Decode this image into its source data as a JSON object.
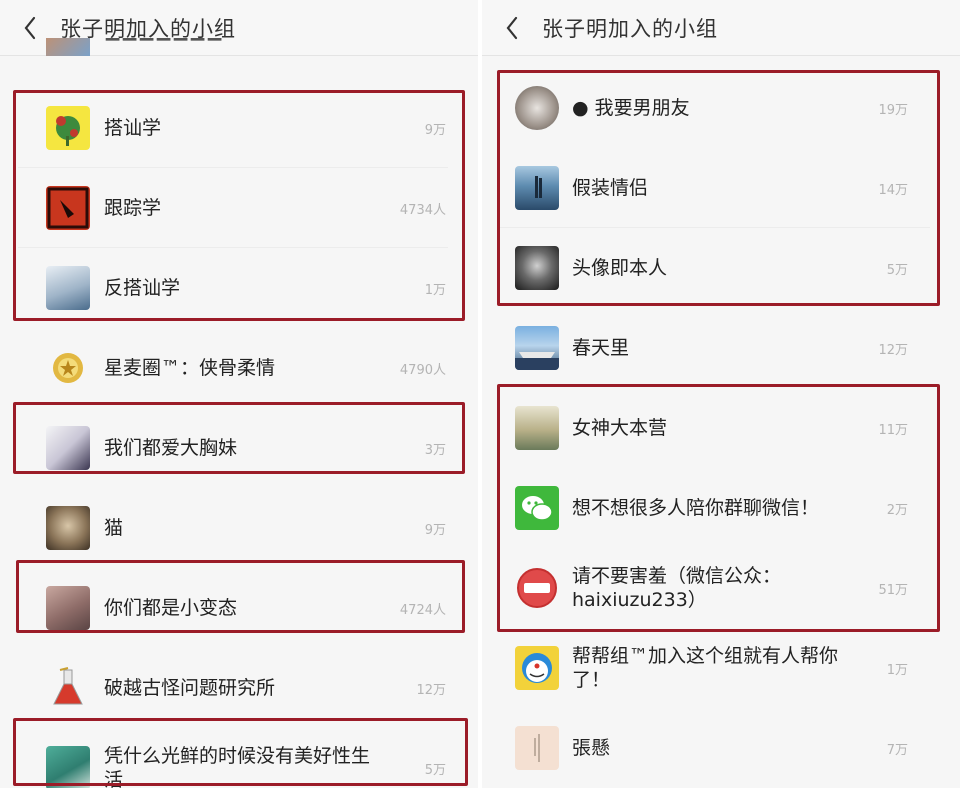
{
  "left_panel": {
    "title": "张子明加入的小组",
    "clipped_top_row": {
      "name": "",
      "avatar_icon": "clipped-avatar-icon"
    },
    "groups": [
      {
        "name": "搭讪学",
        "count": "9万",
        "avatar_icon": "flower-avatar-icon"
      },
      {
        "name": "跟踪学",
        "count": "4734人",
        "avatar_icon": "shoe-avatar-icon"
      },
      {
        "name": "反搭讪学",
        "count": "1万",
        "avatar_icon": "photo-avatar-icon"
      },
      {
        "name": "星麦圈™：侠骨柔情",
        "count": "4790人",
        "avatar_icon": "badge-avatar-icon"
      },
      {
        "name": "我们都爱大胸妹",
        "count": "3万",
        "avatar_icon": "photo-avatar-icon"
      },
      {
        "name": "猫",
        "count": "9万",
        "avatar_icon": "cat-avatar-icon"
      },
      {
        "name": "你们都是小变态",
        "count": "4724人",
        "avatar_icon": "photo-avatar-icon"
      },
      {
        "name": "破越古怪问题研究所",
        "count": "12万",
        "avatar_icon": "flask-avatar-icon"
      },
      {
        "name": "凭什么光鲜的时候没有美好性生活",
        "count": "5万",
        "avatar_icon": "photo-avatar-icon"
      }
    ]
  },
  "right_panel": {
    "title": "张子明加入的小组",
    "groups": [
      {
        "name": "● 我要男朋友",
        "count": "19万",
        "avatar_icon": "sketch-avatar-icon"
      },
      {
        "name": "假装情侣",
        "count": "14万",
        "avatar_icon": "seaside-avatar-icon"
      },
      {
        "name": "头像即本人",
        "count": "5万",
        "avatar_icon": "face-avatar-icon"
      },
      {
        "name": "春天里",
        "count": "12万",
        "avatar_icon": "harbor-avatar-icon"
      },
      {
        "name": "女神大本营",
        "count": "11万",
        "avatar_icon": "photo-avatar-icon"
      },
      {
        "name": "想不想很多人陪你群聊微信！",
        "count": "2万",
        "avatar_icon": "wechat-avatar-icon"
      },
      {
        "name": "请不要害羞（微信公众：haixiuzu233）",
        "count": "51万",
        "avatar_icon": "stamp-avatar-icon"
      },
      {
        "name": "帮帮组™加入这个组就有人帮你了！",
        "count": "1万",
        "avatar_icon": "doraemon-avatar-icon"
      },
      {
        "name": "張懸",
        "count": "7万",
        "avatar_icon": "paper-avatar-icon"
      }
    ]
  },
  "colors": {
    "highlight_frame": "#9b1c28",
    "count_text": "#b4b4b4",
    "background": "#f6f6f6"
  }
}
